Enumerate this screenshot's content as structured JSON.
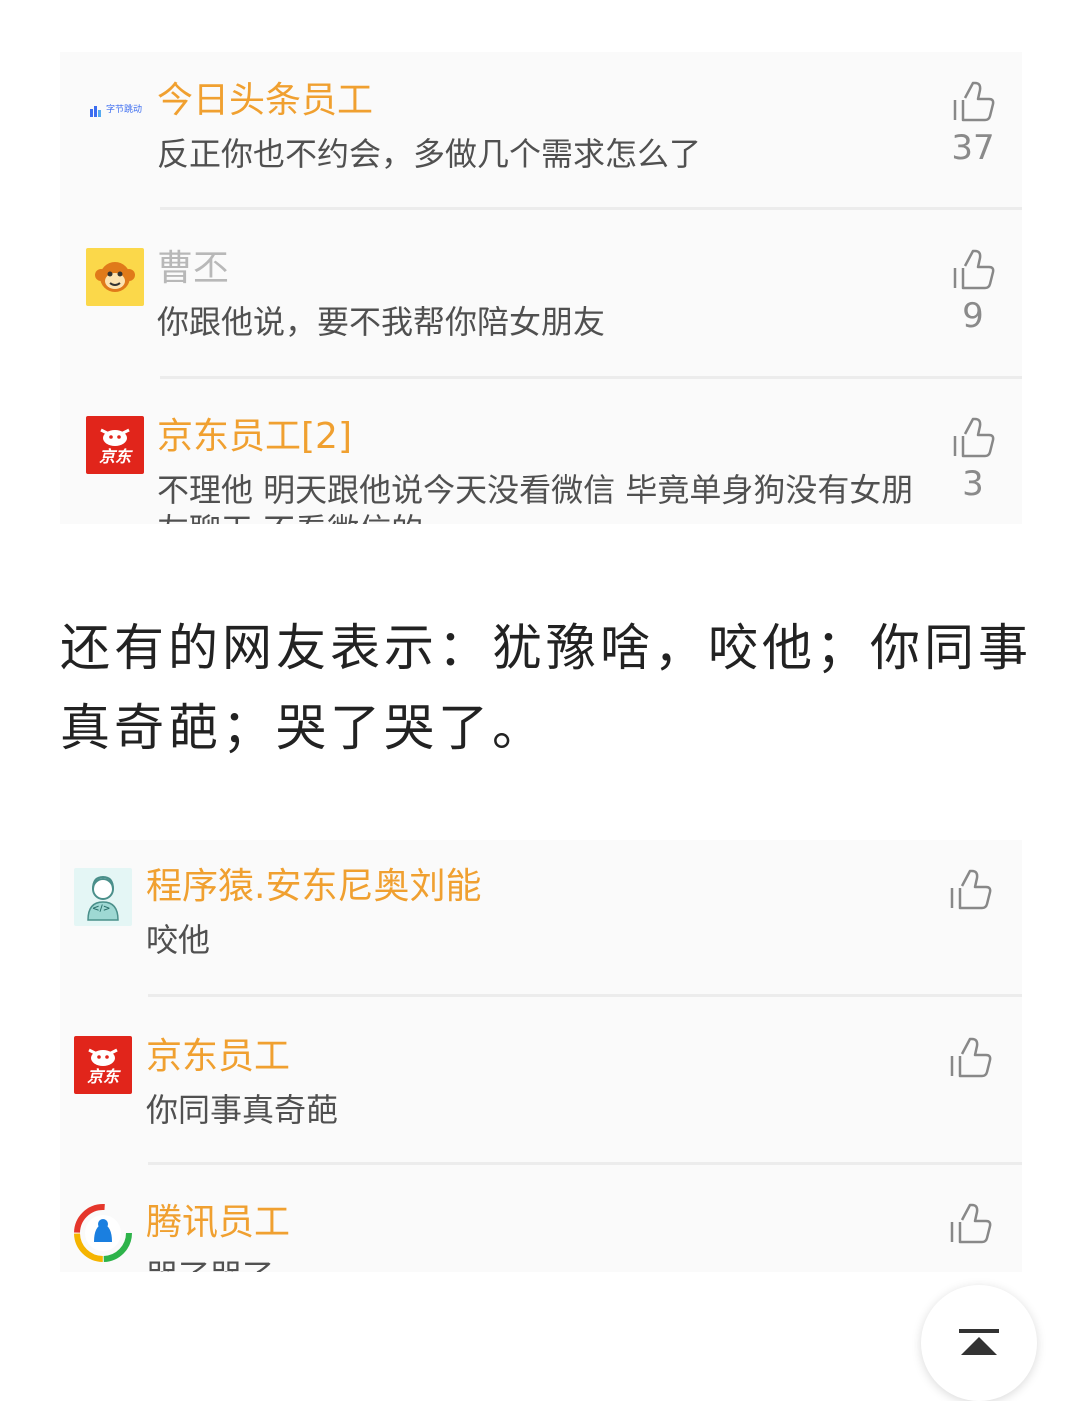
{
  "card1": {
    "comments": [
      {
        "user": "今日头条员工",
        "text": "反正你也不约会，多做几个需求怎么了",
        "likes": "37",
        "avatar_label": "字节跳动"
      },
      {
        "user": "曹丕",
        "text": "你跟他说，要不我帮你陪女朋友",
        "likes": "9"
      },
      {
        "user": "京东员工[2]",
        "text": "不理他 明天跟他说今天没看微信 毕竟单身狗没有女朋",
        "text_cut": "友聊天 不看微信的",
        "likes": "3",
        "avatar_label": "京东"
      }
    ]
  },
  "article": {
    "paragraph": "还有的网友表示：犹豫啥，咬他；你同事真奇葩；哭了哭了。"
  },
  "card2": {
    "comments": [
      {
        "user": "程序猿.安东尼奥刘能",
        "text": "咬他",
        "avatar_label": "</>"
      },
      {
        "user": "京东员工",
        "text": "你同事真奇葩",
        "avatar_label": "京东"
      },
      {
        "user": "腾讯员工",
        "text": "哭了哭了"
      }
    ]
  },
  "colors": {
    "username": "#f0a030",
    "username_gray": "#b8b8b8",
    "jd_red": "#e1251b",
    "card_bg": "#fafafa"
  },
  "icons": {
    "like": "thumbs-up-icon",
    "back_to_top": "arrow-up-icon"
  }
}
